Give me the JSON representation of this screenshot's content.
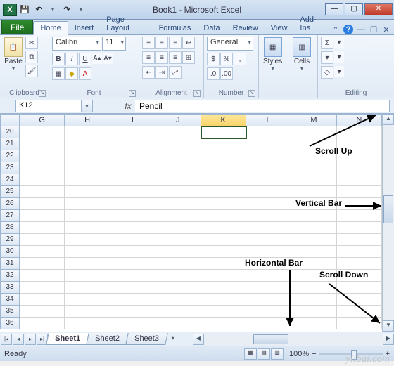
{
  "title": "Book1  -  Microsoft Excel",
  "qat": {
    "save": "💾",
    "undo": "↶",
    "redo": "↷"
  },
  "tabs": {
    "file": "File",
    "items": [
      "Home",
      "Insert",
      "Page Layout",
      "Formulas",
      "Data",
      "Review",
      "View",
      "Add-Ins"
    ],
    "active": "Home"
  },
  "ribbon": {
    "clipboard": {
      "label": "Clipboard",
      "paste": "Paste",
      "cut": "✂",
      "copy": "⧉",
      "painter": "🖌"
    },
    "font": {
      "label": "Font",
      "name": "Calibri",
      "size": "11",
      "bold": "B",
      "italic": "I",
      "underline": "U",
      "border": "▦",
      "fill": "◆",
      "color": "A"
    },
    "alignment": {
      "label": "Alignment",
      "tl": "≡",
      "tc": "≡",
      "tr": "≡",
      "ml": "≡",
      "mc": "≡",
      "mr": "≡",
      "il": "⇤",
      "ir": "⇥",
      "wrap": "↩",
      "merge": "⊞"
    },
    "number": {
      "label": "Number",
      "format": "General",
      "currency": "$",
      "percent": "%",
      "comma": ",",
      "inc": ".0",
      "dec": ".00"
    },
    "styles": {
      "label": "Styles"
    },
    "cells": {
      "label": "Cells"
    },
    "editing": {
      "label": "Editing",
      "sum": "Σ",
      "fill": "▾",
      "clear": "◇"
    }
  },
  "namebox": "K12",
  "formula": "Pencil",
  "columns": [
    "G",
    "H",
    "I",
    "J",
    "K",
    "L",
    "M",
    "N"
  ],
  "selected_col": "K",
  "rows_start": 20,
  "rows_end": 36,
  "anno": {
    "scroll_up": "Scroll Up",
    "vertical_bar": "Vertical Bar",
    "horizontal_bar": "Horizontal Bar",
    "scroll_down": "Scroll Down"
  },
  "sheets": {
    "items": [
      "Sheet1",
      "Sheet2",
      "Sheet3"
    ],
    "active": "Sheet1"
  },
  "status": {
    "ready": "Ready",
    "zoom": "100%"
  },
  "watermark": "yiibai.com"
}
